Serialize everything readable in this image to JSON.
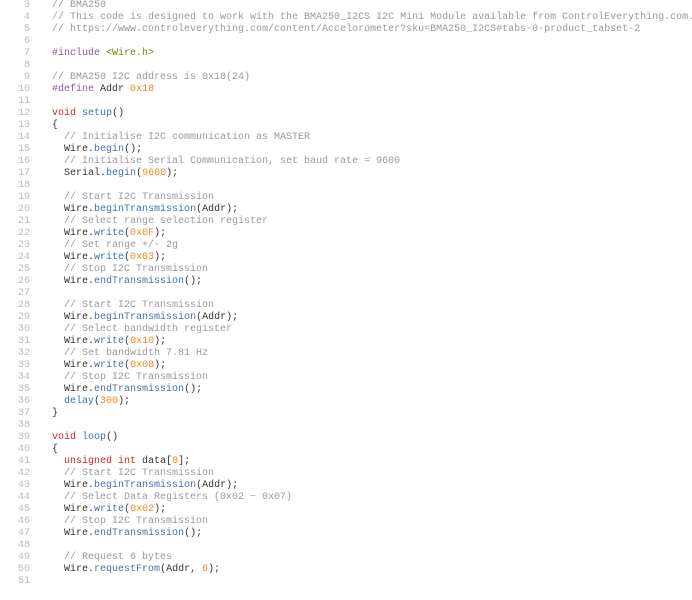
{
  "lines": [
    {
      "n": 3,
      "kind": "comment",
      "indent": 1,
      "text": "// BMA250"
    },
    {
      "n": 4,
      "kind": "comment",
      "indent": 1,
      "text": "// This code is designed to work with the BMA250_I2CS I2C Mini Module available from ControlEverything.com."
    },
    {
      "n": 5,
      "kind": "comment",
      "indent": 1,
      "text": "// https://www.controleverything.com/content/Accelorometer?sku=BMA250_I2CS#tabs-0-product_tabset-2"
    },
    {
      "n": 6,
      "kind": "blank"
    },
    {
      "n": 7,
      "kind": "include",
      "pp": "#include",
      "header": "<Wire.h>"
    },
    {
      "n": 8,
      "kind": "blank"
    },
    {
      "n": 9,
      "kind": "comment",
      "indent": 1,
      "text": "// BMA250 I2C address is 0x18(24)"
    },
    {
      "n": 10,
      "kind": "define",
      "pp": "#define",
      "macro": "Addr",
      "value": "0x18"
    },
    {
      "n": 11,
      "kind": "blank"
    },
    {
      "n": 12,
      "kind": "sig",
      "ret": "void",
      "name": "setup",
      "tail": "()"
    },
    {
      "n": 13,
      "kind": "brace",
      "indent": 1,
      "ch": "{"
    },
    {
      "n": 14,
      "kind": "comment",
      "indent": 2,
      "text": "// Initialise I2C communication as MASTER"
    },
    {
      "n": 15,
      "kind": "call",
      "indent": 2,
      "obj": "Wire",
      "fn": "begin",
      "args": ""
    },
    {
      "n": 16,
      "kind": "comment",
      "indent": 2,
      "text": "// Initialise Serial Communication, set baud rate = 9600"
    },
    {
      "n": 17,
      "kind": "call",
      "indent": 2,
      "obj": "Serial",
      "fn": "begin",
      "args": "9600"
    },
    {
      "n": 18,
      "kind": "blank"
    },
    {
      "n": 19,
      "kind": "comment",
      "indent": 2,
      "text": "// Start I2C Transmission"
    },
    {
      "n": 20,
      "kind": "call",
      "indent": 2,
      "obj": "Wire",
      "fn": "beginTransmission",
      "args": "Addr"
    },
    {
      "n": 21,
      "kind": "comment",
      "indent": 2,
      "text": "// Select range selection register"
    },
    {
      "n": 22,
      "kind": "call",
      "indent": 2,
      "obj": "Wire",
      "fn": "write",
      "args": "0x0F"
    },
    {
      "n": 23,
      "kind": "comment",
      "indent": 2,
      "text": "// Set range +/- 2g"
    },
    {
      "n": 24,
      "kind": "call",
      "indent": 2,
      "obj": "Wire",
      "fn": "write",
      "args": "0x03"
    },
    {
      "n": 25,
      "kind": "comment",
      "indent": 2,
      "text": "// Stop I2C Transmission"
    },
    {
      "n": 26,
      "kind": "call",
      "indent": 2,
      "obj": "Wire",
      "fn": "endTransmission",
      "args": ""
    },
    {
      "n": 27,
      "kind": "blank"
    },
    {
      "n": 28,
      "kind": "comment",
      "indent": 2,
      "text": "// Start I2C Transmission"
    },
    {
      "n": 29,
      "kind": "call",
      "indent": 2,
      "obj": "Wire",
      "fn": "beginTransmission",
      "args": "Addr"
    },
    {
      "n": 30,
      "kind": "comment",
      "indent": 2,
      "text": "// Select bandwidth register"
    },
    {
      "n": 31,
      "kind": "call",
      "indent": 2,
      "obj": "Wire",
      "fn": "write",
      "args": "0x10"
    },
    {
      "n": 32,
      "kind": "comment",
      "indent": 2,
      "text": "// Set bandwidth 7.81 Hz"
    },
    {
      "n": 33,
      "kind": "call",
      "indent": 2,
      "obj": "Wire",
      "fn": "write",
      "args": "0x08"
    },
    {
      "n": 34,
      "kind": "comment",
      "indent": 2,
      "text": "// Stop I2C Transmission"
    },
    {
      "n": 35,
      "kind": "call",
      "indent": 2,
      "obj": "Wire",
      "fn": "endTransmission",
      "args": ""
    },
    {
      "n": 36,
      "kind": "plaincall",
      "indent": 2,
      "fn": "delay",
      "args": "300"
    },
    {
      "n": 37,
      "kind": "brace",
      "indent": 1,
      "ch": "}"
    },
    {
      "n": 38,
      "kind": "blank"
    },
    {
      "n": 39,
      "kind": "sig",
      "ret": "void",
      "name": "loop",
      "tail": "()"
    },
    {
      "n": 40,
      "kind": "brace",
      "indent": 1,
      "ch": "{"
    },
    {
      "n": 41,
      "kind": "decl",
      "indent": 2,
      "type": "unsigned int",
      "name": "data",
      "tail": "[",
      "dim": "0",
      "tail2": "];"
    },
    {
      "n": 42,
      "kind": "comment",
      "indent": 2,
      "text": "// Start I2C Transmission"
    },
    {
      "n": 43,
      "kind": "call",
      "indent": 2,
      "obj": "Wire",
      "fn": "beginTransmission",
      "args": "Addr"
    },
    {
      "n": 44,
      "kind": "comment",
      "indent": 2,
      "text": "// Select Data Registers (0x02 − 0x07)"
    },
    {
      "n": 45,
      "kind": "call",
      "indent": 2,
      "obj": "Wire",
      "fn": "write",
      "args": "0x02"
    },
    {
      "n": 46,
      "kind": "comment",
      "indent": 2,
      "text": "// Stop I2C Transmission"
    },
    {
      "n": 47,
      "kind": "call",
      "indent": 2,
      "obj": "Wire",
      "fn": "endTransmission",
      "args": ""
    },
    {
      "n": 48,
      "kind": "blank"
    },
    {
      "n": 49,
      "kind": "comment",
      "indent": 2,
      "text": "// Request 6 bytes"
    },
    {
      "n": 50,
      "kind": "call2",
      "indent": 2,
      "obj": "Wire",
      "fn": "requestFrom",
      "a1": "Addr",
      "a2": "6"
    },
    {
      "n": 51,
      "kind": "blank"
    }
  ]
}
